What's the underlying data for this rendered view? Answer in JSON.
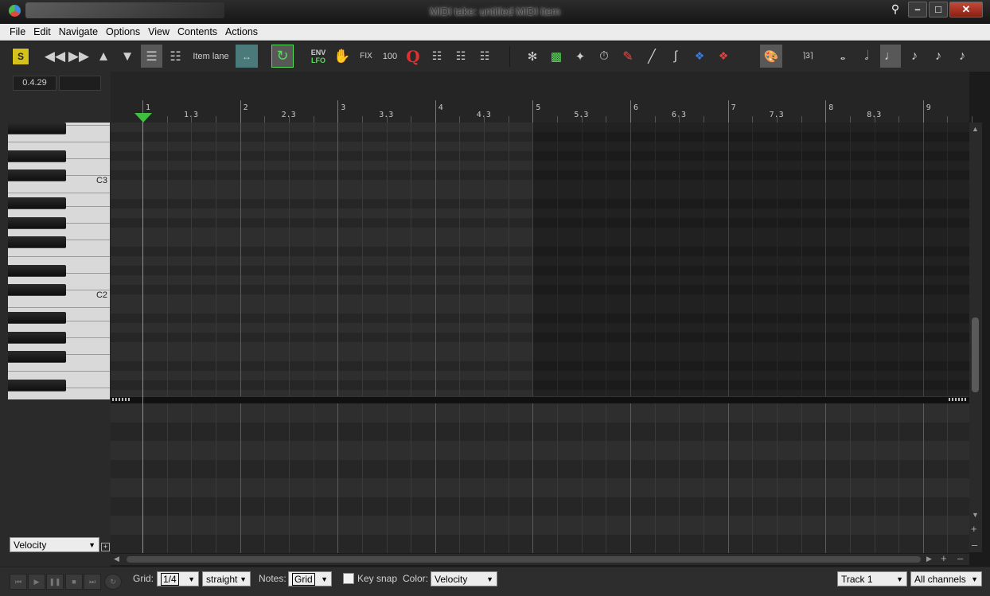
{
  "window": {
    "title": "MIDI take: untitled MIDI item",
    "pin_icon": "pin-icon",
    "minimize_label": "–",
    "maximize_label": "□",
    "close_label": "✕"
  },
  "menu": [
    "File",
    "Edit",
    "Navigate",
    "Options",
    "View",
    "Contents",
    "Actions"
  ],
  "toolbar": {
    "s_label": "S",
    "item_lane_label": "Item lane",
    "env_label": "ENV",
    "lfo_label": "LFO",
    "fix_label": "FIX",
    "hundred_label": "100",
    "q_label": "Q",
    "triplet_label": "⌉3⌉",
    "accent": "#55dd55"
  },
  "position": {
    "time": "0.4.29",
    "secondary": ""
  },
  "ruler": {
    "bars": [
      {
        "label": "1",
        "sub": "1.3"
      },
      {
        "label": "2",
        "sub": "2.3"
      },
      {
        "label": "3",
        "sub": "3.3"
      },
      {
        "label": "4",
        "sub": "4.3"
      },
      {
        "label": "5",
        "sub": "5.3"
      },
      {
        "label": "6",
        "sub": "6.3"
      },
      {
        "label": "7",
        "sub": "7.3"
      },
      {
        "label": "8",
        "sub": "8.3"
      },
      {
        "label": "9",
        "sub": ""
      }
    ]
  },
  "piano": {
    "c3_label": "C3",
    "c2_label": "C2"
  },
  "cc_lane": {
    "selected": "Velocity"
  },
  "bottom": {
    "grid_label": "Grid:",
    "grid_value": "1/4",
    "grid_mode": "straight",
    "notes_label": "Notes:",
    "notes_value": "Grid",
    "key_snap_label": "Key snap",
    "key_snap_checked": false,
    "color_label": "Color:",
    "color_value": "Velocity",
    "track_value": "Track 1",
    "channel_value": "All channels"
  }
}
